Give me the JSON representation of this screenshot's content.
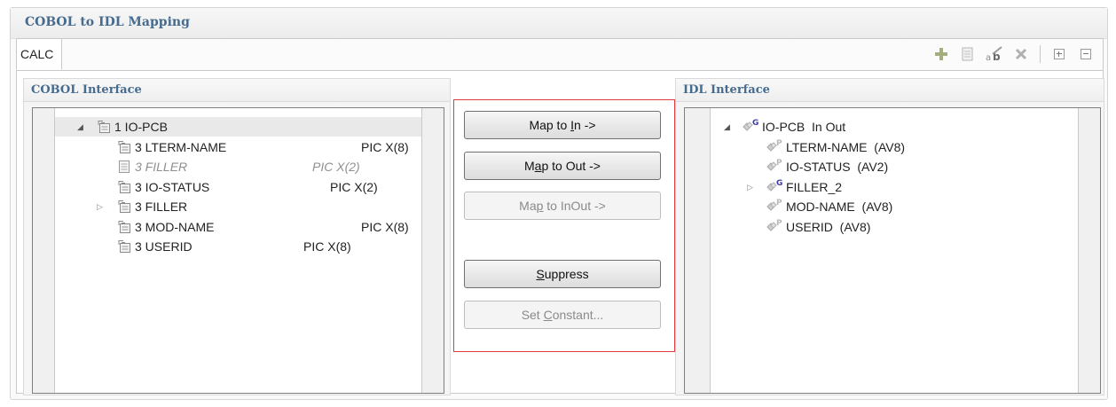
{
  "section": {
    "title": "COBOL to IDL Mapping"
  },
  "tabs": [
    {
      "label": "CALC"
    }
  ],
  "toolbar": {
    "icons": [
      "add-icon",
      "copy-icon",
      "rename-icon",
      "delete-icon",
      "expand-all-icon",
      "collapse-all-icon"
    ]
  },
  "cobol_panel": {
    "title": "COBOL Interface",
    "rows": [
      {
        "label": "1 IO-PCB",
        "pic": "",
        "expander": "open",
        "style": "normal"
      },
      {
        "label": "3 LTERM-NAME",
        "pic": "PIC X(8)",
        "expander": "",
        "style": "normal"
      },
      {
        "label": "3 FILLER",
        "pic": "PIC X(2)",
        "expander": "",
        "style": "dim"
      },
      {
        "label": "3 IO-STATUS",
        "pic": "PIC X(2)",
        "expander": "",
        "style": "normal"
      },
      {
        "label": "3 FILLER",
        "pic": "",
        "expander": "closed",
        "style": "normal"
      },
      {
        "label": "3 MOD-NAME",
        "pic": "PIC X(8)",
        "expander": "",
        "style": "normal"
      },
      {
        "label": "3 USERID",
        "pic": "PIC X(8)",
        "expander": "",
        "style": "normal"
      }
    ]
  },
  "idl_panel": {
    "title": "IDL Interface",
    "rows": [
      {
        "badge": "G",
        "label": "IO-PCB  In Out",
        "expander": "open"
      },
      {
        "badge": "P",
        "label": "LTERM-NAME  (AV8)",
        "expander": ""
      },
      {
        "badge": "P",
        "label": "IO-STATUS  (AV2)",
        "expander": ""
      },
      {
        "badge": "G",
        "label": "FILLER_2",
        "expander": "closed"
      },
      {
        "badge": "P",
        "label": "MOD-NAME  (AV8)",
        "expander": ""
      },
      {
        "badge": "P",
        "label": "USERID  (AV8)",
        "expander": ""
      }
    ]
  },
  "buttons": {
    "map_in": {
      "pre": "Map to ",
      "key": "I",
      "post": "n ->",
      "enabled": true
    },
    "map_out": {
      "pre": "M",
      "key": "a",
      "post": "p to Out ->",
      "enabled": true
    },
    "map_inout": {
      "pre": "Ma",
      "key": "p",
      "post": " to InOut ->",
      "enabled": false
    },
    "suppress": {
      "pre": "",
      "key": "S",
      "post": "uppress",
      "enabled": true
    },
    "set_constant": {
      "pre": "Set ",
      "key": "C",
      "post": "onstant...",
      "enabled": false
    }
  },
  "colors": {
    "title_blue": "#466b8e",
    "highlight_border": "#e0393e",
    "badge_purple": "#3c3ca8"
  }
}
